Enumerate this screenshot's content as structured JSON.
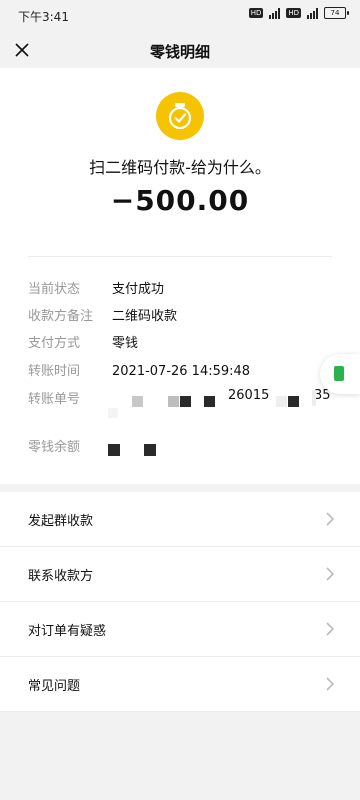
{
  "status_bar": {
    "time": "下午3:41",
    "chip": "HD",
    "net": "4G",
    "battery": "74"
  },
  "nav": {
    "title": "零钱明细"
  },
  "transaction": {
    "merchant": "扫二维码付款-给为什么。",
    "amount": "−500.00",
    "details": [
      {
        "label": "当前状态",
        "value": "支付成功"
      },
      {
        "label": "收款方备注",
        "value": "二维码收款"
      },
      {
        "label": "支付方式",
        "value": "零钱"
      },
      {
        "label": "转账时间",
        "value": "2021-07-26 14:59:48"
      },
      {
        "label": "转账单号",
        "value": "26015",
        "value_tail": "35"
      },
      {
        "label": "零钱余额",
        "value": ""
      }
    ]
  },
  "actions": [
    {
      "label": "发起群收款"
    },
    {
      "label": "联系收款方"
    },
    {
      "label": "对订单有疑惑"
    },
    {
      "label": "常见问题"
    }
  ],
  "colors": {
    "accent": "#f5c300",
    "green": "#2bb24c",
    "label": "#999999"
  }
}
